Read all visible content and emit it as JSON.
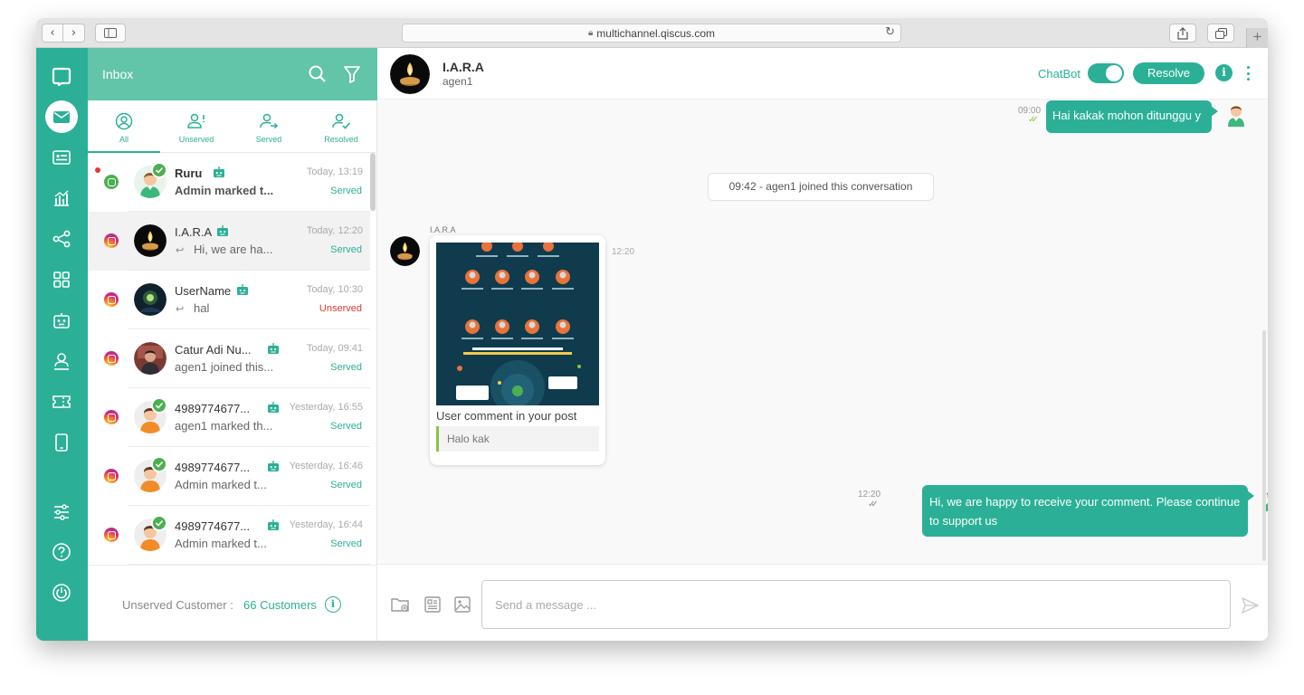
{
  "browser": {
    "url": "multichannel.qiscus.com",
    "back_glyph": "‹",
    "forward_glyph": "›",
    "new_tab_glyph": "+"
  },
  "sidebar": {
    "items": [
      {
        "name": "qiscus-logo",
        "icon": "logo-icon"
      },
      {
        "name": "inbox",
        "icon": "mail-icon",
        "active": true
      },
      {
        "name": "contacts",
        "icon": "id-card-icon"
      },
      {
        "name": "analytics",
        "icon": "chart-icon"
      },
      {
        "name": "integrations",
        "icon": "share-icon"
      },
      {
        "name": "apps",
        "icon": "grid-icon"
      },
      {
        "name": "bot",
        "icon": "robot-icon"
      },
      {
        "name": "agents",
        "icon": "agent-icon"
      },
      {
        "name": "tickets",
        "icon": "ticket-icon"
      },
      {
        "name": "mobile",
        "icon": "mobile-icon"
      },
      {
        "name": "settings",
        "icon": "sliders-icon"
      },
      {
        "name": "help",
        "icon": "question-icon"
      },
      {
        "name": "logout",
        "icon": "power-icon"
      }
    ]
  },
  "inbox": {
    "title": "Inbox",
    "tabs": [
      {
        "label": "All",
        "active": true
      },
      {
        "label": "Unserved"
      },
      {
        "label": "Served"
      },
      {
        "label": "Resolved"
      }
    ],
    "conversations": [
      {
        "name": "Ruru",
        "bold": true,
        "time": "Today, 13:19",
        "preview": "Admin marked t...",
        "status": "Served",
        "channel": "qiscus",
        "unread": true,
        "reply": false,
        "avatar": "boy-avatar",
        "check": true
      },
      {
        "name": "I.A.R.A",
        "bold": false,
        "time": "Today, 12:20",
        "preview": "Hi, we are ha...",
        "status": "Served",
        "channel": "instagram",
        "unread": false,
        "reply": true,
        "avatar": "candle-avatar",
        "check": false,
        "selected": true
      },
      {
        "name": "UserName",
        "bold": false,
        "time": "Today, 10:30",
        "preview": "hal",
        "status": "Unserved",
        "channel": "instagram",
        "unread": false,
        "reply": true,
        "avatar": "night-avatar",
        "check": false
      },
      {
        "name": "Catur Adi Nu...",
        "bold": false,
        "time": "Today, 09:41",
        "preview": "agen1 joined this...",
        "status": "Served",
        "channel": "instagram",
        "unread": false,
        "reply": false,
        "avatar": "photo-avatar",
        "check": false
      },
      {
        "name": "4989774677...",
        "bold": false,
        "time": "Yesterday, 16:55",
        "preview": "agen1 marked th...",
        "status": "Served",
        "channel": "instagram",
        "unread": false,
        "reply": false,
        "avatar": "man-avatar",
        "check": true
      },
      {
        "name": "4989774677...",
        "bold": false,
        "time": "Yesterday, 16:46",
        "preview": "Admin marked t...",
        "status": "Served",
        "channel": "instagram",
        "unread": false,
        "reply": false,
        "avatar": "man-avatar",
        "check": true
      },
      {
        "name": "4989774677...",
        "bold": false,
        "time": "Yesterday, 16:44",
        "preview": "Admin marked t...",
        "status": "Served",
        "channel": "instagram",
        "unread": false,
        "reply": false,
        "avatar": "man-avatar",
        "check": true
      }
    ],
    "footer": {
      "label": "Unserved Customer :",
      "count": "66 Customers",
      "info_glyph": "i"
    }
  },
  "chat": {
    "name": "I.A.R.A",
    "agent": "agen1",
    "chatbot_label": "ChatBot",
    "chatbot_enabled": true,
    "resolve_label": "Resolve",
    "info_glyph": "i",
    "messages": {
      "out1": {
        "text": "Hai kakak mohon ditunggu y",
        "time": "09:00",
        "ticks": "✓✓"
      },
      "system": "09:42 - agen1 joined this conversation",
      "incoming": {
        "sender": "I.A.R.A",
        "caption": "User comment in your post",
        "comment": "Halo kak",
        "time": "12:20"
      },
      "out2": {
        "text": "Hi, we are happy to receive your comment. Please continue to support us",
        "time": "12:20",
        "ticks": "✓✓"
      }
    },
    "composer": {
      "placeholder": "Send a message ..."
    }
  },
  "colors": {
    "brand": "#2bb097",
    "header": "#62c4a9",
    "served": "#2bb097",
    "unserved": "#e53935"
  }
}
